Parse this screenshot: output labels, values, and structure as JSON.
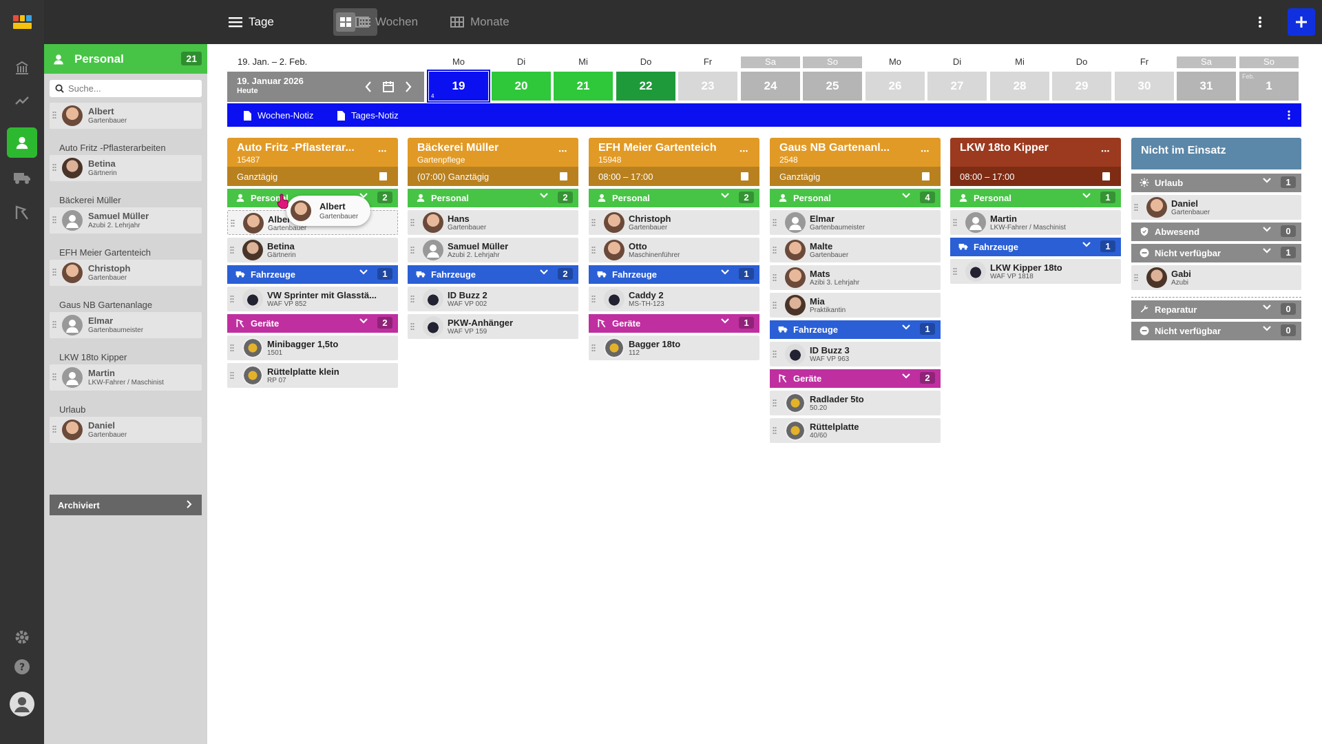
{
  "colors": {
    "green": "#47c446",
    "blue": "#2a5fd6",
    "magenta": "#bf2fa0",
    "orange": "#e19a26",
    "brown": "#9b3a1f",
    "accent": "#1030e0",
    "notebar": "#0a10f0"
  },
  "topbar": {
    "days_label": "Tage",
    "weeks_label": "Wochen",
    "months_label": "Monate"
  },
  "panel": {
    "title": "Personal",
    "count": "21",
    "search_placeholder": "Suche...",
    "groups": [
      {
        "label": "",
        "people": [
          {
            "name": "Albert",
            "role": "Gartenbauer"
          }
        ]
      },
      {
        "label": "Auto Fritz -Pflasterarbeiten",
        "people": [
          {
            "name": "Betina",
            "role": "Gärtnerin"
          }
        ]
      },
      {
        "label": "Bäckerei Müller",
        "people": [
          {
            "name": "Samuel Müller",
            "role": "Azubi 2. Lehrjahr"
          }
        ]
      },
      {
        "label": "EFH Meier Gartenteich",
        "people": [
          {
            "name": "Christoph",
            "role": "Gartenbauer"
          }
        ]
      },
      {
        "label": "Gaus NB Gartenanlage",
        "people": [
          {
            "name": "Elmar",
            "role": "Gartenbaumeister"
          }
        ]
      },
      {
        "label": "LKW 18to Kipper",
        "people": [
          {
            "name": "Martin",
            "role": "LKW-Fahrer / Maschinist"
          }
        ]
      },
      {
        "label": "Urlaub",
        "people": [
          {
            "name": "Daniel",
            "role": "Gartenbauer"
          }
        ]
      }
    ],
    "archived_label": "Archiviert"
  },
  "calendar": {
    "range": "19. Jan. – 2. Feb.",
    "current_date": "19. Januar 2026",
    "today_label": "Heute",
    "week_number": "4",
    "days": [
      {
        "name": "Mo",
        "num": "19",
        "color": "#0a10f0",
        "weekend": false
      },
      {
        "name": "Di",
        "num": "20",
        "color": "#2ec83a",
        "weekend": false
      },
      {
        "name": "Mi",
        "num": "21",
        "color": "#2ec83a",
        "weekend": false
      },
      {
        "name": "Do",
        "num": "22",
        "color": "#1f9a3a",
        "weekend": false
      },
      {
        "name": "Fr",
        "num": "23",
        "color": "#d8d8d8",
        "weekend": false
      },
      {
        "name": "Sa",
        "num": "24",
        "color": "#b5b5b5",
        "weekend": true
      },
      {
        "name": "So",
        "num": "25",
        "color": "#b5b5b5",
        "weekend": true
      },
      {
        "name": "Mo",
        "num": "26",
        "color": "#d8d8d8",
        "weekend": false
      },
      {
        "name": "Di",
        "num": "27",
        "color": "#d8d8d8",
        "weekend": false
      },
      {
        "name": "Mi",
        "num": "28",
        "color": "#d8d8d8",
        "weekend": false
      },
      {
        "name": "Do",
        "num": "29",
        "color": "#d8d8d8",
        "weekend": false
      },
      {
        "name": "Fr",
        "num": "30",
        "color": "#d8d8d8",
        "weekend": false
      },
      {
        "name": "Sa",
        "num": "31",
        "color": "#b5b5b5",
        "weekend": true
      },
      {
        "name": "So",
        "num": "1",
        "color": "#b5b5b5",
        "weekend": true
      }
    ],
    "feb_label": "Feb.",
    "week_note": "Wochen-Notiz",
    "day_note": "Tages-Notiz"
  },
  "columns": [
    {
      "title": "Auto Fritz -Pflasterar...",
      "sub": "15487",
      "time": "Ganztägig",
      "personal": {
        "label": "Personal",
        "count": "2",
        "items": [
          {
            "name": "Albert",
            "role": "Gartenbauer"
          },
          {
            "name": "Betina",
            "role": "Gärtnerin"
          }
        ]
      },
      "vehicles": {
        "label": "Fahrzeuge",
        "count": "1",
        "items": [
          {
            "name": "VW Sprinter mit Glasstä...",
            "role": "WAF VP 852"
          }
        ]
      },
      "tools": {
        "label": "Geräte",
        "count": "2",
        "items": [
          {
            "name": "Minibagger 1,5to",
            "role": "1501"
          },
          {
            "name": "Rüttelplatte klein",
            "role": "RP 07"
          }
        ]
      }
    },
    {
      "title": "Bäckerei Müller",
      "sub": "Gartenpflege",
      "time": "(07:00)  Ganztägig",
      "personal": {
        "label": "Personal",
        "count": "2",
        "items": [
          {
            "name": "Hans",
            "role": "Gartenbauer"
          },
          {
            "name": "Samuel Müller",
            "role": "Azubi 2. Lehrjahr"
          }
        ]
      },
      "vehicles": {
        "label": "Fahrzeuge",
        "count": "2",
        "items": [
          {
            "name": "ID Buzz 2",
            "role": "WAF VP 002"
          },
          {
            "name": "PKW-Anhänger",
            "role": "WAF VP 159"
          }
        ]
      }
    },
    {
      "title": "EFH Meier Gartenteich",
      "sub": "15948",
      "time": "08:00 – 17:00",
      "personal": {
        "label": "Personal",
        "count": "2",
        "items": [
          {
            "name": "Christoph",
            "role": "Gartenbauer"
          },
          {
            "name": "Otto",
            "role": "Maschinenführer"
          }
        ]
      },
      "vehicles": {
        "label": "Fahrzeuge",
        "count": "1",
        "items": [
          {
            "name": "Caddy 2",
            "role": "MS-TH-123"
          }
        ]
      },
      "tools": {
        "label": "Geräte",
        "count": "1",
        "items": [
          {
            "name": "Bagger 18to",
            "role": "112"
          }
        ]
      }
    },
    {
      "title": "Gaus NB Gartenanl...",
      "sub": "2548",
      "time": "Ganztägig",
      "personal": {
        "label": "Personal",
        "count": "4",
        "items": [
          {
            "name": "Elmar",
            "role": "Gartenbaumeister"
          },
          {
            "name": "Malte",
            "role": "Gartenbauer"
          },
          {
            "name": "Mats",
            "role": "Azibi 3. Lehrjahr"
          },
          {
            "name": "Mia",
            "role": "Praktikantin"
          }
        ]
      },
      "vehicles": {
        "label": "Fahrzeuge",
        "count": "1",
        "items": [
          {
            "name": "ID Buzz 3",
            "role": "WAF VP 963"
          }
        ]
      },
      "tools": {
        "label": "Geräte",
        "count": "2",
        "items": [
          {
            "name": "Radlader 5to",
            "role": "50.20"
          },
          {
            "name": "Rüttelplatte",
            "role": "40/60"
          }
        ]
      }
    },
    {
      "title": "LKW 18to Kipper",
      "sub": "",
      "time": "08:00 – 17:00",
      "personal": {
        "label": "Personal",
        "count": "1",
        "items": [
          {
            "name": "Martin",
            "role": "LKW-Fahrer / Maschinist"
          }
        ]
      },
      "vehicles": {
        "label": "Fahrzeuge",
        "count": "1",
        "items": [
          {
            "name": "LKW Kipper 18to",
            "role": "WAF VP 1818"
          }
        ]
      }
    }
  ],
  "absent": {
    "title": "Nicht im Einsatz",
    "sections": [
      {
        "label": "Urlaub",
        "count": "1",
        "items": [
          {
            "name": "Daniel",
            "role": "Gartenbauer"
          }
        ]
      },
      {
        "label": "Abwesend",
        "count": "0",
        "items": []
      },
      {
        "label": "Nicht verfügbar",
        "count": "1",
        "items": [
          {
            "name": "Gabi",
            "role": "Azubi"
          }
        ]
      }
    ],
    "equipment_sections": [
      {
        "label": "Reparatur",
        "count": "0"
      },
      {
        "label": "Nicht verfügbar",
        "count": "0"
      }
    ]
  },
  "drag": {
    "name": "Albert",
    "role": "Gartenbauer"
  }
}
